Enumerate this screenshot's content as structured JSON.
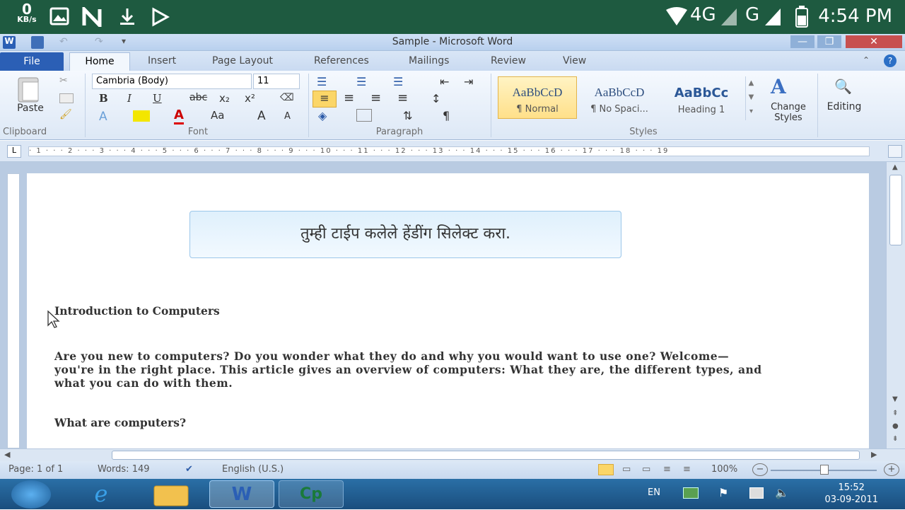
{
  "android": {
    "speed_value": "0",
    "speed_unit": "KB/s",
    "network": "4G",
    "network2": "G",
    "time": "4:54 PM"
  },
  "window": {
    "title": "Sample - Microsoft Word"
  },
  "tabs": [
    "File",
    "Home",
    "Insert",
    "Page Layout",
    "References",
    "Mailings",
    "Review",
    "View"
  ],
  "ribbon": {
    "clipboard": {
      "paste": "Paste",
      "label": "Clipboard"
    },
    "font": {
      "name": "Cambria (Body)",
      "size": "11",
      "label": "Font",
      "bold": "B",
      "italic": "I",
      "underline": "U",
      "strike": "abc",
      "sub": "x₂",
      "sup": "x²",
      "color": "A",
      "case": "Aa",
      "grow": "A",
      "shrink": "A"
    },
    "paragraph": {
      "label": "Paragraph",
      "pilcrow": "¶"
    },
    "styles": {
      "label": "Styles",
      "items": [
        {
          "sample": "AaBbCcD",
          "name": "¶ Normal"
        },
        {
          "sample": "AaBbCcD",
          "name": "¶ No Spaci..."
        },
        {
          "sample": "AaBbCc",
          "name": "Heading 1"
        }
      ],
      "change": "Change Styles"
    },
    "editing": {
      "label": "Editing"
    }
  },
  "ruler": {
    "marks": "· 1 · · · 2 · · · 3 · · · 4 · · · 5 · · · 6 · · · 7 · · · 8 · · · 9 · · · 10 · · · 11 · · · 12 · · · 13 · · · 14 · · · 15 · · · 16 · · · 17 · · · 18 · · · 19"
  },
  "caption": "तुम्ही टाईप कलेले हेंडींग सिलेक्ट करा.",
  "document": {
    "heading": "Introduction to Computers",
    "paragraph": "Are you new to computers? Do you wonder what they do and why you would want to use one? Welcome—you're in the right place. This article gives an overview of computers: What they are, the different types, and what you can do with them.",
    "subheading": "What are computers?"
  },
  "status": {
    "page": "Page: 1 of 1",
    "words": "Words: 149",
    "language": "English (U.S.)",
    "zoom": "100%"
  },
  "taskbar": {
    "lang": "EN",
    "time": "15:52",
    "date": "03-09-2011",
    "word_label": "W",
    "cp_label": "Cp"
  }
}
